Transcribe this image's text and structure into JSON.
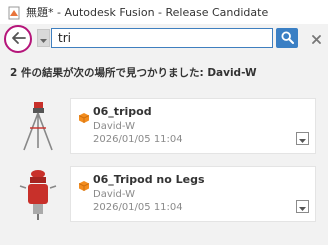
{
  "window": {
    "title": "無題* - Autodesk Fusion - Release Candidate"
  },
  "search": {
    "query": "tri",
    "summary": "2 件の結果が次の場所で見つかりました: David-W"
  },
  "results": [
    {
      "name": "06_tripod",
      "owner": "David-W",
      "date": "2026/01/05 11:04"
    },
    {
      "name": "06_Tripod no Legs",
      "owner": "David-W",
      "date": "2026/01/05 11:04"
    }
  ],
  "colors": {
    "accent": "#3a7fc4",
    "back_ring": "#b5157a",
    "component_icon": "#f28c1e",
    "tripod_red": "#c8302a"
  },
  "icons": {
    "app": "fusion-file-icon",
    "back": "arrow-left-icon",
    "search": "magnifier-icon",
    "clear": "close-icon",
    "component": "component-cube-icon",
    "menu": "chevron-down-icon"
  }
}
